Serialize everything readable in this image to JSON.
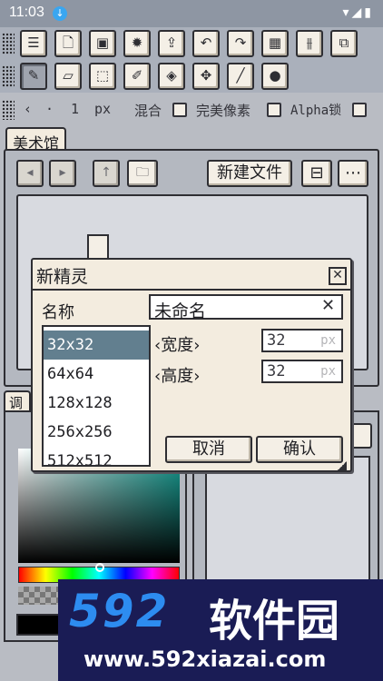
{
  "status_bar": {
    "time": "11:03",
    "download_icon": "download-badge-icon",
    "icons": "▾◢▮"
  },
  "toolbar1": {
    "buttons": [
      {
        "name": "settings-sliders-icon",
        "glyph": "☰"
      },
      {
        "name": "new-file-icon",
        "glyph": "🗋"
      },
      {
        "name": "save-icon",
        "glyph": "▣"
      },
      {
        "name": "gear-icon",
        "glyph": "✹"
      },
      {
        "name": "export-icon",
        "glyph": "⇪"
      },
      {
        "name": "undo-icon",
        "glyph": "↶"
      },
      {
        "name": "redo-icon",
        "glyph": "↷"
      },
      {
        "name": "grid-icon",
        "glyph": "▦"
      },
      {
        "name": "adjust-icon",
        "glyph": "⫵"
      },
      {
        "name": "mirror-icon",
        "glyph": "⧉"
      }
    ]
  },
  "toolbar2": {
    "buttons": [
      {
        "name": "pencil-icon",
        "glyph": "✎",
        "active": true
      },
      {
        "name": "eraser-icon",
        "glyph": "▱"
      },
      {
        "name": "select-rect-icon",
        "glyph": "⬚"
      },
      {
        "name": "eyedropper-icon",
        "glyph": "✐"
      },
      {
        "name": "fill-bucket-icon",
        "glyph": "◈"
      },
      {
        "name": "move-icon",
        "glyph": "✥"
      },
      {
        "name": "line-icon",
        "glyph": "╱"
      },
      {
        "name": "shape-fill-icon",
        "glyph": "●"
      }
    ]
  },
  "toolbar3": {
    "prev": "‹",
    "dot": "·",
    "brush_size": "1",
    "unit": "px",
    "blend_label": "混合",
    "pixel_perfect_label": "完美像素",
    "alpha_lock_label": "Alpha锁"
  },
  "gallery": {
    "tab_label": "美术馆",
    "new_file_label": "新建文件",
    "nav": [
      "◂",
      "▸",
      "↑",
      "🗀"
    ],
    "extra": [
      "⊟",
      "⋯"
    ]
  },
  "tune_tab_label": "调",
  "dialog": {
    "title": "新精灵",
    "close_glyph": "✕",
    "name_label": "名称",
    "name_value": "未命名",
    "name_clear": "✕",
    "sizes": [
      "32x32",
      "64x64",
      "128x128",
      "256x256",
      "512x512"
    ],
    "selected_size": "32x32",
    "width_label": "‹宽度›",
    "height_label": "‹高度›",
    "width_value": "32",
    "height_value": "32",
    "unit": "px",
    "cancel_label": "取消",
    "ok_label": "确认"
  },
  "watermark": {
    "logo": "592",
    "name": "软件园",
    "url": "www.592xiazai.com"
  }
}
